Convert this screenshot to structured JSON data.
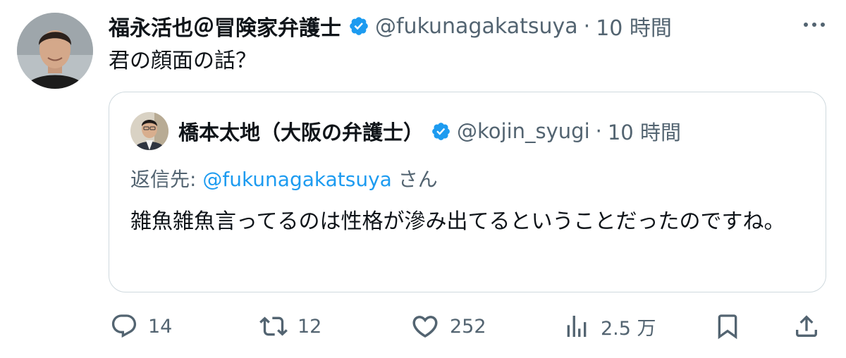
{
  "tweet": {
    "author_name": "福永活也＠冒険家弁護士",
    "handle": "@fukunagakatsuya",
    "separator": "·",
    "time": "10 時間",
    "text": "君の顔面の話？"
  },
  "quote": {
    "author_name": "橋本太地（大阪の弁護士）",
    "handle": "@kojin_syugi",
    "separator": "·",
    "time": "10 時間",
    "reply_prefix": "返信先: ",
    "reply_handle": "@fukunagakatsuya",
    "reply_suffix": " さん",
    "text": "雑魚雑魚言ってるのは性格が滲み出てるということだったのですね。"
  },
  "actions": {
    "replies": "14",
    "reposts": "12",
    "likes": "252",
    "views": "2.5 万"
  },
  "icons": {
    "verified": "verified-badge-icon",
    "more": "more-icon",
    "reply": "reply-icon",
    "repost": "repost-icon",
    "like": "heart-icon",
    "views": "views-icon",
    "bookmark": "bookmark-icon",
    "share": "share-icon"
  },
  "colors": {
    "text": "#0f1419",
    "muted": "#536471",
    "link": "#1d9bf0",
    "verified": "#1d9bf0",
    "border": "#cfd9de"
  }
}
